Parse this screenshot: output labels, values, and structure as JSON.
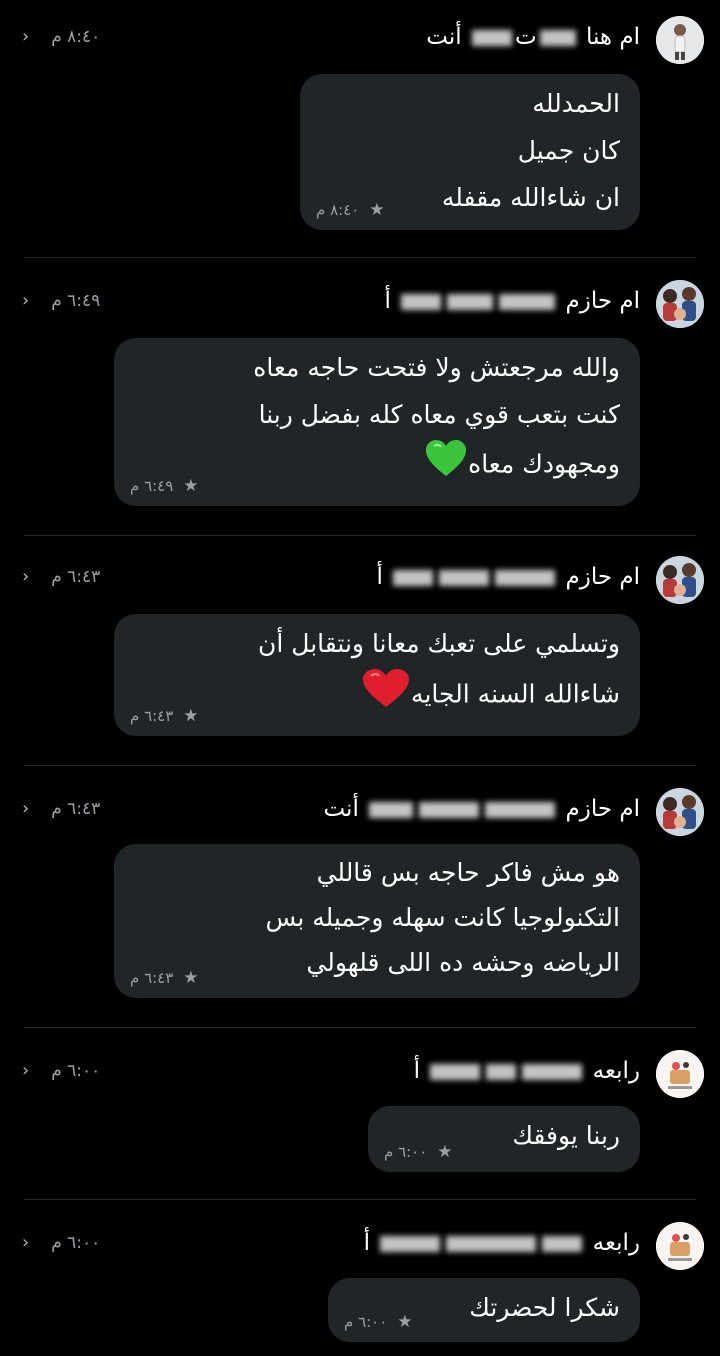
{
  "messages": [
    {
      "sender": "ام هنا",
      "sender_suffix": "ت",
      "sender_tail": "أنت",
      "time": "٨:٤٠ م",
      "lines": [
        "الحمدلله",
        "كان جميل",
        "ان شاءالله مقفله"
      ],
      "bubble_time": "٨:٤٠ م"
    },
    {
      "sender": "ام حازم",
      "sender_tail": "أ",
      "time": "٦:٤٩ م",
      "lines": [
        "والله مرجعتش ولا فتحت حاجه معاه",
        "كنت بتعب قوي معاه كله بفضل ربنا",
        "ومجهودك معاه"
      ],
      "bubble_time": "٦:٤٩ م"
    },
    {
      "sender": "ام حازم",
      "sender_tail": "أ",
      "time": "٦:٤٣ م",
      "lines": [
        "وتسلمي على تعبك معانا ونتقابل أن",
        "شاءالله السنه الجايه"
      ],
      "bubble_time": "٦:٤٣ م"
    },
    {
      "sender": "ام حازم",
      "sender_tail": "أنت",
      "time": "٦:٤٣ م",
      "lines": [
        "هو مش فاكر حاجه بس قاللي",
        "التكنولوجيا كانت سهله وجميله بس",
        "الرياضه وحشه ده اللى قلهولي"
      ],
      "bubble_time": "٦:٤٣ م"
    },
    {
      "sender": "رابعه",
      "sender_tail": "أ",
      "time": "٦:٠٠ م",
      "lines": [
        "ربنا يوفقك"
      ],
      "bubble_time": "٦:٠٠ م"
    },
    {
      "sender": "رابعه",
      "sender_tail": "أ",
      "time": "٦:٠٠ م",
      "lines": [
        "شكرا لحضرتك"
      ],
      "bubble_time": "٦:٠٠ م"
    }
  ],
  "icons": {
    "chevron": "chevron-right-icon",
    "star": "star-icon",
    "green_heart": "green-heart-emoji",
    "red_heart": "red-heart-emoji"
  },
  "colors": {
    "background": "#000000",
    "bubble": "#202528",
    "meta_text": "#9aa0a6",
    "divider": "#26292c"
  }
}
